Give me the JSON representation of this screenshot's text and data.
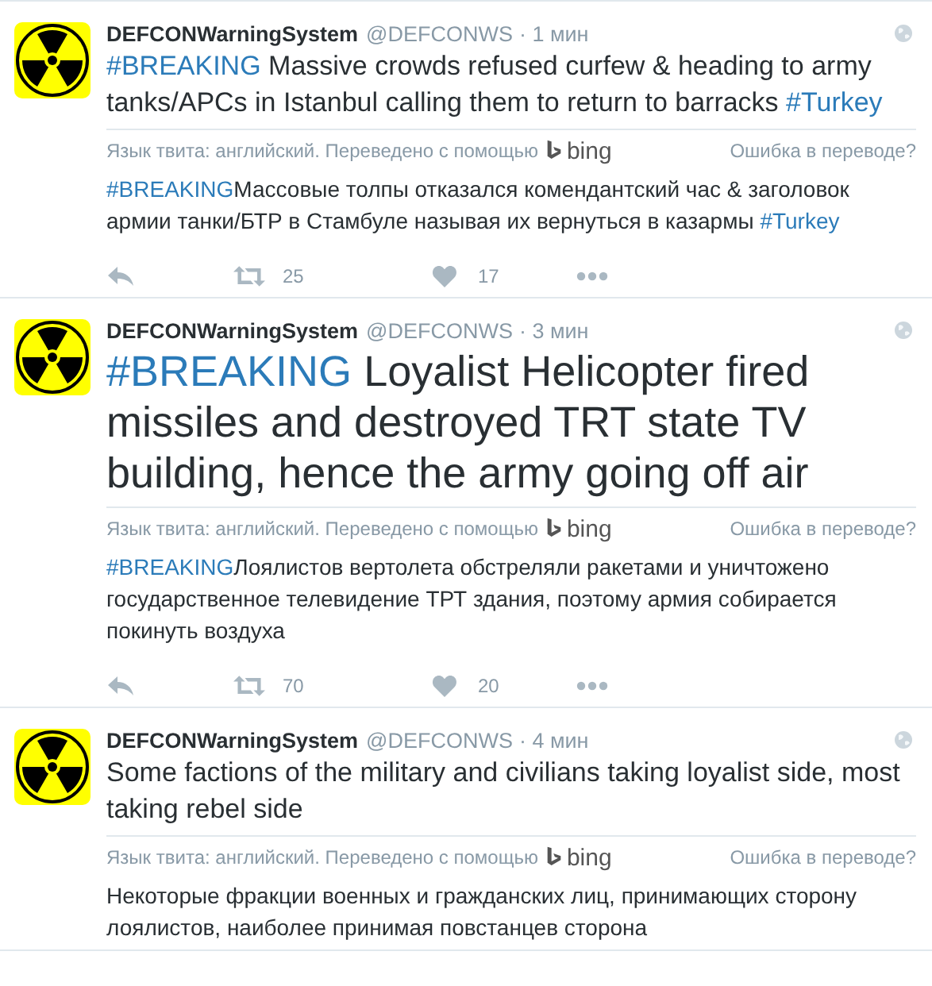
{
  "tweets": [
    {
      "name": "DEFCONWarningSystem",
      "handle": "@DEFCONWS",
      "time": "· 1 мин",
      "large_text": false,
      "text": [
        {
          "kind": "hashtag",
          "text": "#BREAKING"
        },
        {
          "kind": "plain",
          "text": " Massive crowds refused curfew & heading to army tanks/APCs in Istanbul calling them to return to barracks "
        },
        {
          "kind": "hashtag",
          "text": "#Turkey"
        }
      ],
      "translation_note": "Язык твита: английский. Переведено с помощью",
      "translator": "bing",
      "report_link": "Ошибка в переводе?",
      "translation": [
        {
          "kind": "hashtag",
          "text": "#BREAKING"
        },
        {
          "kind": "plain",
          "text": "Массовые толпы отказался комендантский час & заголовок армии танки/БТР в Стамбуле называя их вернуться в казармы "
        },
        {
          "kind": "hashtag",
          "text": "#Turkey"
        }
      ],
      "retweets": "25",
      "likes": "17"
    },
    {
      "name": "DEFCONWarningSystem",
      "handle": "@DEFCONWS",
      "time": "· 3 мин",
      "large_text": true,
      "text": [
        {
          "kind": "hashtag",
          "text": "#BREAKING"
        },
        {
          "kind": "plain",
          "text": " Loyalist Helicopter fired missiles and destroyed TRT state TV building, hence the army going off air"
        }
      ],
      "translation_note": "Язык твита: английский. Переведено с помощью",
      "translator": "bing",
      "report_link": "Ошибка в переводе?",
      "translation": [
        {
          "kind": "hashtag",
          "text": "#BREAKING"
        },
        {
          "kind": "plain",
          "text": "Лоялистов вертолета обстреляли ракетами и уничтожено государственное телевидение ТРТ здания, поэтому армия собирается покинуть воздуха"
        }
      ],
      "retweets": "70",
      "likes": "20"
    },
    {
      "name": "DEFCONWarningSystem",
      "handle": "@DEFCONWS",
      "time": "· 4 мин",
      "large_text": false,
      "text": [
        {
          "kind": "plain",
          "text": "Some factions of the military and civilians taking loyalist side, most taking rebel side"
        }
      ],
      "translation_note": "Язык твита: английский. Переведено с помощью",
      "translator": "bing",
      "report_link": "Ошибка в переводе?",
      "translation": [
        {
          "kind": "plain",
          "text": "Некоторые фракции военных и гражданских лиц, принимающих сторону лоялистов, наиболее принимая повстанцев сторона"
        }
      ]
    }
  ]
}
